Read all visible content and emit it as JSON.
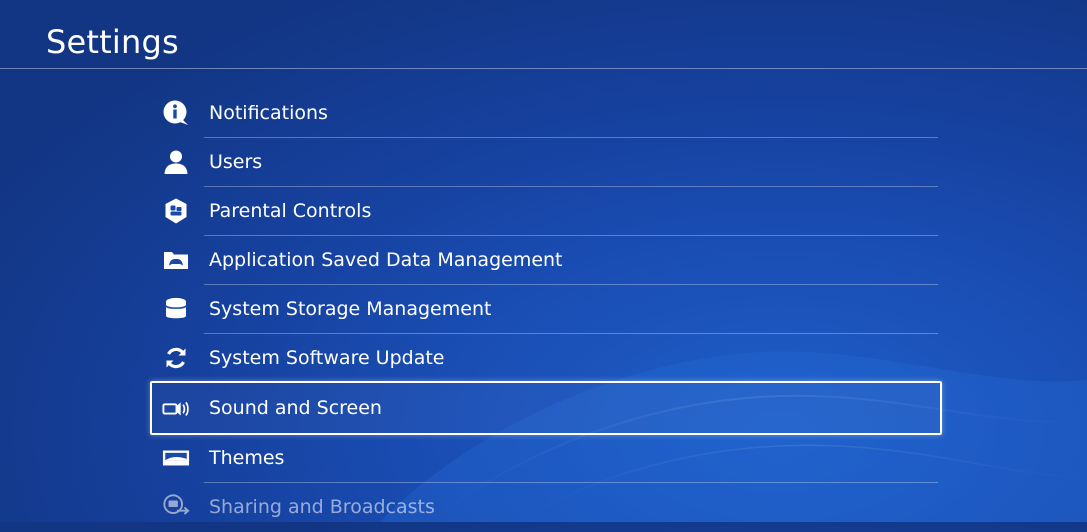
{
  "header": {
    "title": "Settings"
  },
  "menu": {
    "items": [
      {
        "label": "Notifications",
        "icon": "notification-info-icon"
      },
      {
        "label": "Users",
        "icon": "user-icon"
      },
      {
        "label": "Parental Controls",
        "icon": "parental-controls-shield-icon"
      },
      {
        "label": "Application Saved Data Management",
        "icon": "saved-data-folder-icon"
      },
      {
        "label": "System Storage Management",
        "icon": "storage-cylinder-icon"
      },
      {
        "label": "System Software Update",
        "icon": "update-arrows-icon"
      },
      {
        "label": "Sound and Screen",
        "icon": "sound-screen-icon",
        "selected": true
      },
      {
        "label": "Themes",
        "icon": "themes-icon"
      },
      {
        "label": "Sharing and Broadcasts",
        "icon": "sharing-broadcast-icon"
      }
    ]
  },
  "colors": {
    "background": "#16419f",
    "text": "#ffffff",
    "selection_border": "#ffffff"
  }
}
